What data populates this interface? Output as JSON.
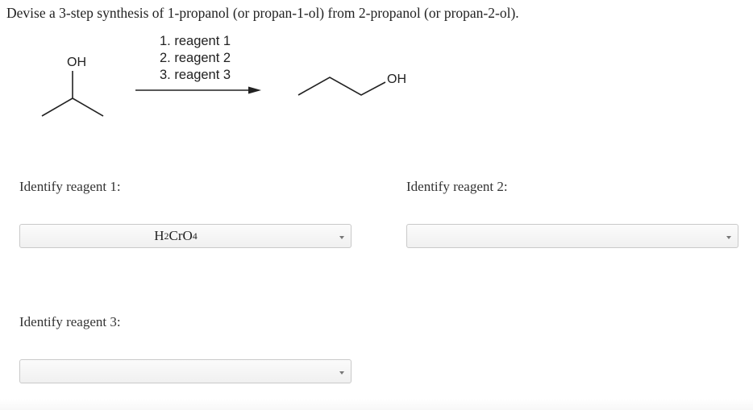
{
  "question": "Devise a 3-step synthesis of 1-propanol (or propan-1-ol) from 2-propanol (or propan-2-ol).",
  "scheme": {
    "reactant_label": "OH",
    "product_label": "OH",
    "steps": [
      "1. reagent 1",
      "2. reagent 2",
      "3. reagent 3"
    ]
  },
  "reagent1": {
    "prompt": "Identify reagent 1:",
    "value_main": "H",
    "value_sub1": "2",
    "value_mid": "CrO",
    "value_sub2": "4"
  },
  "reagent2": {
    "prompt": "Identify reagent 2:",
    "value": ""
  },
  "reagent3": {
    "prompt": "Identify reagent 3:",
    "value": ""
  },
  "icons": {
    "dropdown": "caret-down-icon",
    "arrow": "reaction-arrow-icon"
  }
}
